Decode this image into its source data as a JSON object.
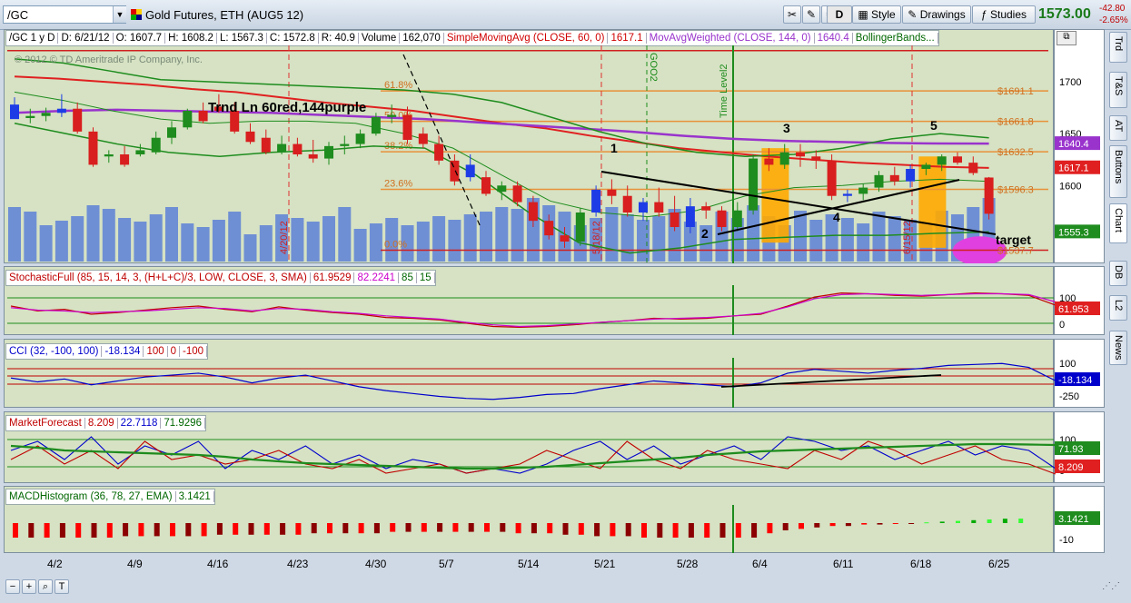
{
  "toolbar": {
    "symbol": "/GC",
    "instrument": "Gold Futures, ETH (AUG5 12)",
    "buttons": {
      "d": "D",
      "style": "Style",
      "drawings": "Drawings",
      "studies": "Studies"
    },
    "last_price": "1573.00",
    "change": "-42.80",
    "change_pct": "-2.65%"
  },
  "side_tabs": [
    "Trd",
    "T&S",
    "AT",
    "Buttons",
    "Chart",
    "DB",
    "L2",
    "News"
  ],
  "price_panel": {
    "header": [
      "/GC 1 y D",
      "D: 6/21/12",
      "O: 1607.7",
      "H: 1608.2",
      "L: 1567.3",
      "C: 1572.8",
      "R: 40.9",
      "Volume",
      "162,070",
      "SimpleMovingAvg (CLOSE, 60, 0)",
      "1617.1",
      "MovAvgWeighted (CLOSE, 144, 0)",
      "1640.4",
      "BollingerBands..."
    ],
    "header_colors": [
      "#000000",
      "#000000",
      "#000000",
      "#000000",
      "#000000",
      "#000000",
      "#000000",
      "#000000",
      "#000000",
      "#d00000",
      "#d00000",
      "#9933cc",
      "#9933cc",
      "#006600"
    ],
    "copyright": "© 2012 © TD Ameritrade IP Company, Inc.",
    "annotation": "Trnd Ln 60red,144purple",
    "fib_left": [
      "61.8%",
      "50.0%",
      "38.2%",
      "23.6%",
      "0.0%"
    ],
    "fib_right": [
      "$1691.1",
      "$1661.8",
      "$1632.5",
      "$1596.3",
      "$1537.7"
    ],
    "y_labels": [
      "1700",
      "1650",
      "1600"
    ],
    "tags": {
      "wma": "1640.4",
      "sma": "1617.1",
      "bb": "1555.3"
    },
    "date_markers": [
      "4/20/12",
      "5/18/12",
      "6/15/12"
    ],
    "vertical_labels": [
      "GOO2",
      "Time Level2"
    ],
    "wave_labels": [
      "1",
      "2",
      "3",
      "4",
      "5"
    ],
    "target": "target"
  },
  "stoch_panel": {
    "header": [
      "StochasticFull (85, 15, 14, 3, (H+L+C)/3, LOW, CLOSE, 3, SMA)",
      "61.9529",
      "82.2241",
      "85",
      "15"
    ],
    "header_colors": [
      "#c00000",
      "#c00000",
      "#cc00cc",
      "#006600",
      "#006600"
    ],
    "y_labels": [
      "100",
      "0"
    ],
    "tag": "61.953"
  },
  "cci_panel": {
    "header": [
      "CCI (32, -100, 100)",
      "-18.134",
      "100",
      "0",
      "-100"
    ],
    "header_colors": [
      "#0000cc",
      "#0000cc",
      "#c00000",
      "#c00000",
      "#c00000"
    ],
    "y_labels": [
      "100",
      "-250"
    ],
    "tag": "-18.134"
  },
  "mf_panel": {
    "header": [
      "MarketForecast",
      "8.209",
      "22.7118",
      "71.9296"
    ],
    "header_colors": [
      "#c00000",
      "#c00000",
      "#0000cc",
      "#006600"
    ],
    "y_labels": [
      "100",
      "0"
    ],
    "tags": {
      "green": "71.93",
      "red": "8.209"
    }
  },
  "macd_panel": {
    "header": [
      "MACDHistogram (36, 78, 27, EMA)",
      "3.1421"
    ],
    "header_colors": [
      "#006600",
      "#006600"
    ],
    "y_labels": [
      "-10"
    ],
    "tag": "3.1421"
  },
  "x_axis": [
    "4/2",
    "4/9",
    "4/16",
    "4/23",
    "4/30",
    "5/7",
    "5/14",
    "5/21",
    "5/28",
    "6/4",
    "6/11",
    "6/18",
    "6/25"
  ],
  "colors": {
    "panel_bg": "#d6e2c3",
    "up_candle": "#1e8c1e",
    "down_candle": "#d81e1e",
    "blue_candle": "#1e3ce6",
    "volume": "#6f8fd4",
    "sma": "#e02020",
    "wma": "#9933cc",
    "bollinger": "#1e8c1e",
    "fib": "#e8913a",
    "highlight": "#ffaa00",
    "target": "#e040e0"
  },
  "chart_data": {
    "type": "candlestick",
    "x_labels": [
      "4/2",
      "4/9",
      "4/16",
      "4/23",
      "4/30",
      "5/7",
      "5/14",
      "5/21",
      "5/28",
      "6/4",
      "6/11",
      "6/18",
      "6/25"
    ],
    "y_range": [
      1525,
      1735
    ],
    "candles": [
      [
        1678,
        1685,
        1665,
        1664
      ],
      [
        1665,
        1674,
        1660,
        1667
      ],
      [
        1667,
        1675,
        1662,
        1670
      ],
      [
        1670,
        1688,
        1666,
        1674
      ],
      [
        1674,
        1680,
        1650,
        1652
      ],
      [
        1652,
        1656,
        1618,
        1620
      ],
      [
        1628,
        1634,
        1622,
        1630
      ],
      [
        1630,
        1638,
        1618,
        1620
      ],
      [
        1630,
        1640,
        1628,
        1634
      ],
      [
        1632,
        1652,
        1630,
        1646
      ],
      [
        1646,
        1662,
        1640,
        1656
      ],
      [
        1656,
        1674,
        1654,
        1672
      ],
      [
        1672,
        1680,
        1660,
        1662
      ],
      [
        1676,
        1688,
        1670,
        1672
      ],
      [
        1672,
        1680,
        1650,
        1652
      ],
      [
        1652,
        1660,
        1640,
        1642
      ],
      [
        1646,
        1654,
        1630,
        1632
      ],
      [
        1632,
        1648,
        1630,
        1640
      ],
      [
        1640,
        1646,
        1628,
        1630
      ],
      [
        1630,
        1644,
        1622,
        1626
      ],
      [
        1626,
        1642,
        1620,
        1638
      ],
      [
        1638,
        1648,
        1630,
        1640
      ],
      [
        1640,
        1654,
        1636,
        1650
      ],
      [
        1650,
        1670,
        1648,
        1666
      ],
      [
        1666,
        1678,
        1660,
        1668
      ],
      [
        1668,
        1676,
        1640,
        1644
      ],
      [
        1650,
        1656,
        1636,
        1640
      ],
      [
        1640,
        1648,
        1620,
        1624
      ],
      [
        1624,
        1630,
        1600,
        1604
      ],
      [
        1620,
        1630,
        1604,
        1608
      ],
      [
        1608,
        1614,
        1590,
        1592
      ],
      [
        1594,
        1604,
        1586,
        1600
      ],
      [
        1600,
        1604,
        1580,
        1584
      ],
      [
        1584,
        1590,
        1560,
        1566
      ],
      [
        1566,
        1572,
        1548,
        1552
      ],
      [
        1552,
        1560,
        1540,
        1546
      ],
      [
        1546,
        1578,
        1542,
        1574
      ],
      [
        1574,
        1600,
        1570,
        1596
      ],
      [
        1596,
        1606,
        1582,
        1590
      ],
      [
        1590,
        1600,
        1570,
        1574
      ],
      [
        1574,
        1588,
        1566,
        1584
      ],
      [
        1584,
        1598,
        1570,
        1574
      ],
      [
        1574,
        1590,
        1556,
        1560
      ],
      [
        1560,
        1588,
        1554,
        1580
      ],
      [
        1580,
        1584,
        1568,
        1576
      ],
      [
        1576,
        1580,
        1556,
        1560
      ],
      [
        1560,
        1584,
        1556,
        1576
      ],
      [
        1576,
        1630,
        1572,
        1626
      ],
      [
        1626,
        1636,
        1614,
        1620
      ],
      [
        1620,
        1640,
        1616,
        1632
      ],
      [
        1632,
        1640,
        1618,
        1628
      ],
      [
        1628,
        1634,
        1616,
        1624
      ],
      [
        1624,
        1630,
        1586,
        1590
      ],
      [
        1590,
        1596,
        1584,
        1592
      ],
      [
        1592,
        1602,
        1586,
        1598
      ],
      [
        1598,
        1614,
        1594,
        1610
      ],
      [
        1610,
        1618,
        1600,
        1604
      ],
      [
        1604,
        1620,
        1598,
        1616
      ],
      [
        1616,
        1622,
        1610,
        1620
      ],
      [
        1620,
        1630,
        1614,
        1628
      ],
      [
        1628,
        1632,
        1620,
        1622
      ],
      [
        1622,
        1628,
        1610,
        1612
      ],
      [
        1607.7,
        1608.2,
        1567.3,
        1572.8
      ]
    ],
    "series": [
      {
        "name": "SimpleMovingAvg (CLOSE, 60, 0)",
        "last": 1617.1
      },
      {
        "name": "MovAvgWeighted (CLOSE, 144, 0)",
        "last": 1640.4
      },
      {
        "name": "BollingerBands...",
        "last": 1555.3
      }
    ],
    "fib_levels": [
      {
        "label": "61.8%",
        "value": 1691.1
      },
      {
        "label": "50.0%",
        "value": 1661.8
      },
      {
        "label": "38.2%",
        "value": 1632.5
      },
      {
        "label": "23.6%",
        "value": 1596.3
      },
      {
        "label": "0.0%",
        "value": 1537.7
      }
    ],
    "grid": true
  }
}
